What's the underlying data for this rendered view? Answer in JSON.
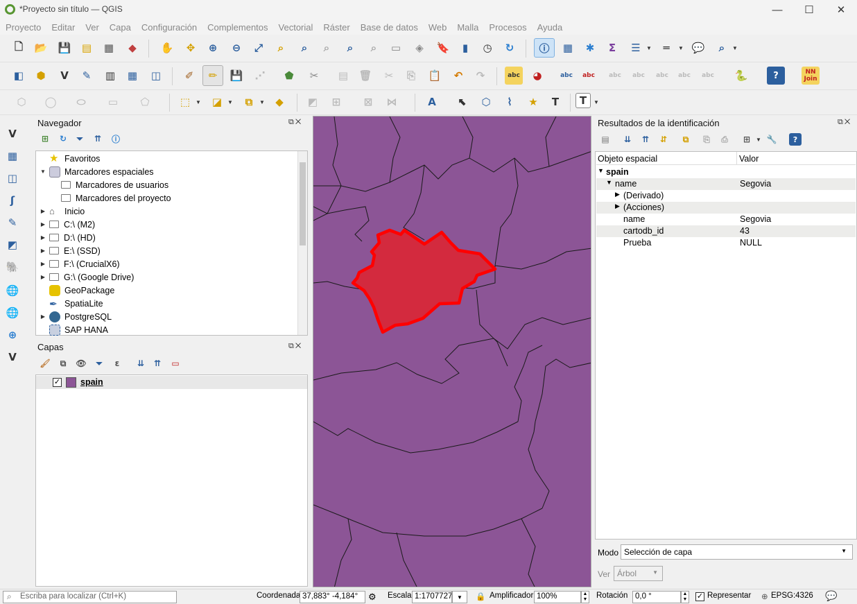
{
  "window": {
    "title": "*Proyecto sin título — QGIS",
    "min": "—",
    "max": "☐",
    "close": "✕"
  },
  "menu": [
    "Proyecto",
    "Editar",
    "Ver",
    "Capa",
    "Configuración",
    "Complementos",
    "Vectorial",
    "Ráster",
    "Base de datos",
    "Web",
    "Malla",
    "Procesos",
    "Ayuda"
  ],
  "toolbar_icons": {
    "nnjoin_line1": "NN",
    "nnjoin_line2": "Join",
    "abc": "abc",
    "label_T": "T",
    "help": "?"
  },
  "navigator": {
    "title": "Navegador",
    "items": [
      {
        "label": "Favoritos",
        "icon": "star-icon"
      },
      {
        "label": "Marcadores espaciales",
        "icon": "bookmark-icon"
      },
      {
        "label": "Marcadores de usuarios",
        "icon": "folder-icon"
      },
      {
        "label": "Marcadores del proyecto",
        "icon": "folder-icon"
      },
      {
        "label": "Inicio",
        "icon": "home-icon"
      },
      {
        "label": "C:\\ (M2)",
        "icon": "folder-icon"
      },
      {
        "label": "D:\\ (HD)",
        "icon": "folder-icon"
      },
      {
        "label": "E:\\ (SSD)",
        "icon": "folder-icon"
      },
      {
        "label": "F:\\ (CrucialX6)",
        "icon": "folder-icon"
      },
      {
        "label": "G:\\ (Google Drive)",
        "icon": "folder-icon"
      },
      {
        "label": "GeoPackage",
        "icon": "geopackage-icon"
      },
      {
        "label": "SpatiaLite",
        "icon": "spatialite-icon"
      },
      {
        "label": "PostgreSQL",
        "icon": "postgresql-icon"
      },
      {
        "label": "SAP HANA",
        "icon": "saphana-icon"
      }
    ]
  },
  "layers": {
    "title": "Capas",
    "items": [
      {
        "name": "spain",
        "checked": true
      }
    ]
  },
  "identify": {
    "title": "Resultados de la identificación",
    "headers": {
      "feature": "Objeto espacial",
      "value": "Valor"
    },
    "rows": [
      {
        "label": "spain",
        "value": ""
      },
      {
        "label": "name",
        "value": "Segovia"
      },
      {
        "label": "(Derivado)",
        "value": ""
      },
      {
        "label": "(Acciones)",
        "value": ""
      },
      {
        "label": "name",
        "value": "Segovia"
      },
      {
        "label": "cartodb_id",
        "value": "43"
      },
      {
        "label": "Prueba",
        "value": "NULL"
      }
    ],
    "mode_label": "Modo",
    "mode_value": "Selección de capa",
    "view_label": "Ver",
    "view_value": "Árbol"
  },
  "status": {
    "locator_placeholder": "Escriba para localizar (Ctrl+K)",
    "coord_label": "Coordenada",
    "coord_value": "37,883° -4,184°",
    "scale_label": "Escala",
    "scale_value": "1:1707727",
    "magnifier_label": "Amplificador",
    "magnifier_value": "100%",
    "rotation_label": "Rotación",
    "rotation_value": "0,0 °",
    "render_label": "Representar",
    "render_checked": true,
    "crs": "EPSG:4326"
  },
  "colors": {
    "map_fill": "#8c5596",
    "selection": "#ff0000",
    "selection_fill": "#d32a3e",
    "accent": "#3a86c8"
  }
}
